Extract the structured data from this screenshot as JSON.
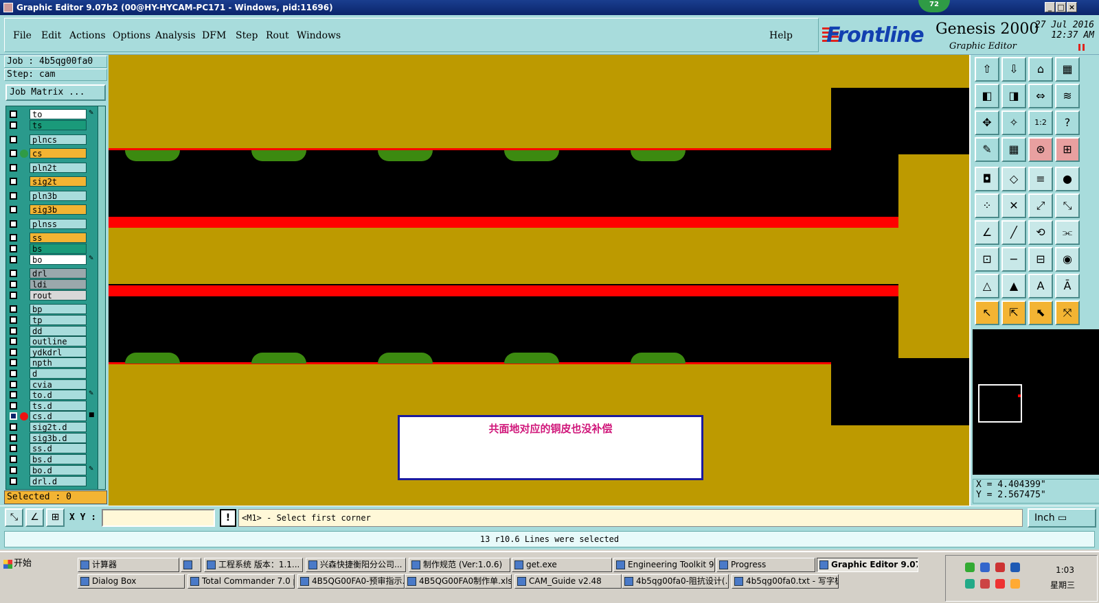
{
  "window": {
    "title": "Graphic Editor 9.07b2 (00@HY-HYCAM-PC171 - Windows, pid:11696)",
    "badge": "72",
    "min": "_",
    "max": "□",
    "close": "×"
  },
  "menu": {
    "items": [
      "File",
      "Edit",
      "Actions",
      "Options",
      "Analysis",
      "DFM",
      "Step",
      "Rout",
      "Windows"
    ],
    "help": "Help"
  },
  "brand": {
    "logo": "Frontline",
    "product": "Genesis 2000",
    "subtitle": "Graphic Editor",
    "date": "27 Jul 2016",
    "time": "12:37 AM"
  },
  "left": {
    "job": "Job : 4b5qg00fa0",
    "step": "Step: cam",
    "job_matrix": "Job Matrix ...",
    "selected": "Selected : 0"
  },
  "layers": [
    {
      "name": "to",
      "color": "#ffffff",
      "flag": "✎"
    },
    {
      "name": "ts",
      "color": "#1a9a7a",
      "flag": ""
    },
    {
      "name": "plncs",
      "color": "#a8dcdc",
      "flag": ""
    },
    {
      "name": "cs",
      "color": "#f3b433",
      "flag": "",
      "dot": "#2f9b45"
    },
    {
      "name": "pln2t",
      "color": "#a8dcdc",
      "flag": ""
    },
    {
      "name": "sig2t",
      "color": "#f3b433",
      "flag": ""
    },
    {
      "name": "pln3b",
      "color": "#a8dcdc",
      "flag": ""
    },
    {
      "name": "sig3b",
      "color": "#f3b433",
      "flag": ""
    },
    {
      "name": "plnss",
      "color": "#a8dcdc",
      "flag": ""
    },
    {
      "name": "ss",
      "color": "#f3b433",
      "flag": ""
    },
    {
      "name": "bs",
      "color": "#1a9a7a",
      "flag": ""
    },
    {
      "name": "bo",
      "color": "#ffffff",
      "flag": "✎"
    },
    {
      "name": "drl",
      "color": "#9aa8ac",
      "flag": ""
    },
    {
      "name": "ldi",
      "color": "#9aa8ac",
      "flag": ""
    },
    {
      "name": "rout",
      "color": "#d8d8d8",
      "flag": ""
    },
    {
      "name": "bp",
      "color": "#a8dcdc",
      "flag": ""
    },
    {
      "name": "tp",
      "color": "#a8dcdc",
      "flag": ""
    },
    {
      "name": "dd",
      "color": "#a8dcdc",
      "flag": ""
    },
    {
      "name": "outline",
      "color": "#a8dcdc",
      "flag": ""
    },
    {
      "name": "ydkdrl",
      "color": "#a8dcdc",
      "flag": ""
    },
    {
      "name": "npth",
      "color": "#a8dcdc",
      "flag": ""
    },
    {
      "name": "d",
      "color": "#a8dcdc",
      "flag": ""
    },
    {
      "name": "cvia",
      "color": "#a8dcdc",
      "flag": ""
    },
    {
      "name": "to.d",
      "color": "#a8dcdc",
      "flag": "✎"
    },
    {
      "name": "ts.d",
      "color": "#a8dcdc",
      "flag": ""
    },
    {
      "name": "cs.d",
      "color": "#a8dcdc",
      "flag": "■",
      "dot": "#ee1111",
      "checked": true
    },
    {
      "name": "sig2t.d",
      "color": "#a8dcdc",
      "flag": ""
    },
    {
      "name": "sig3b.d",
      "color": "#a8dcdc",
      "flag": ""
    },
    {
      "name": "ss.d",
      "color": "#a8dcdc",
      "flag": ""
    },
    {
      "name": "bs.d",
      "color": "#a8dcdc",
      "flag": ""
    },
    {
      "name": "bo.d",
      "color": "#a8dcdc",
      "flag": "✎"
    },
    {
      "name": "drl.d",
      "color": "#a8dcdc",
      "flag": ""
    }
  ],
  "canvas": {
    "note": "共面地对应的铜皮也没补偿"
  },
  "tools": [
    {
      "icon": "⇧",
      "name": "zoom-home-icon"
    },
    {
      "icon": "⇩",
      "name": "zoom-save-icon"
    },
    {
      "icon": "⌂",
      "name": "home-icon"
    },
    {
      "icon": "▦",
      "name": "window-icon"
    },
    {
      "icon": "◧",
      "name": "pan-left-icon"
    },
    {
      "icon": "◨",
      "name": "pan-right-icon"
    },
    {
      "icon": "⇔",
      "name": "zoom-width-icon"
    },
    {
      "icon": "≋",
      "name": "redraw-icon"
    },
    {
      "icon": "✥",
      "name": "fit-icon"
    },
    {
      "icon": "✧",
      "name": "center-icon"
    },
    {
      "icon": "1:2",
      "name": "scale-icon"
    },
    {
      "icon": "?",
      "name": "help-icon"
    },
    {
      "icon": "✎",
      "name": "pencil-icon"
    },
    {
      "icon": "▦",
      "name": "grid-icon"
    },
    {
      "icon": "⊛",
      "name": "snap-red-icon"
    },
    {
      "icon": "⊞",
      "name": "snap-grid-icon"
    },
    {
      "icon": "◘",
      "name": "pad-icon"
    },
    {
      "icon": "◇",
      "name": "surface-icon"
    },
    {
      "icon": "≡",
      "name": "ruler-icon"
    },
    {
      "icon": "●",
      "name": "circle-icon"
    },
    {
      "icon": "⁘",
      "name": "nodes-icon"
    },
    {
      "icon": "✕",
      "name": "cross-icon"
    },
    {
      "icon": "⤢",
      "name": "line-add-icon"
    },
    {
      "icon": "⤡",
      "name": "line-move-icon"
    },
    {
      "icon": "∠",
      "name": "angle-icon"
    },
    {
      "icon": "╱",
      "name": "diag-icon"
    },
    {
      "icon": "⟲",
      "name": "arc-icon"
    },
    {
      "icon": "⫘",
      "name": "mirror-icon"
    },
    {
      "icon": "⊡",
      "name": "pad-move-icon"
    },
    {
      "icon": "−",
      "name": "minus-icon"
    },
    {
      "icon": "⊟",
      "name": "measure-icon"
    },
    {
      "icon": "◉",
      "name": "blob-icon"
    },
    {
      "icon": "△",
      "name": "tri-1-icon"
    },
    {
      "icon": "▲",
      "name": "tri-2-icon"
    },
    {
      "icon": "A",
      "name": "tri-3-icon"
    },
    {
      "icon": "Ā",
      "name": "tri-4-icon"
    },
    {
      "icon": "↖",
      "name": "select-icon"
    },
    {
      "icon": "⇱",
      "name": "select-box-icon"
    },
    {
      "icon": "⬉",
      "name": "select-poly-icon"
    },
    {
      "icon": "⤧",
      "name": "select-net-icon"
    }
  ],
  "coords": {
    "x": "X = 4.404399\"",
    "y": "Y = 2.567475\""
  },
  "cmd": {
    "xy_label": "X Y :",
    "xy_value": "",
    "warn": "!",
    "prompt": "<M1> - Select first corner",
    "units": "Inch ▭"
  },
  "status": {
    "message": "13 r10.6 Lines were selected"
  },
  "taskbar": {
    "start": "开始",
    "row1": [
      "计算器",
      "",
      "工程系统  版本：1.1...",
      "兴森快捷衡阳分公司...",
      "制作规范 (Ver:1.0.6)",
      "get.exe",
      "Engineering Toolkit 9.0...",
      "Progress",
      "Graphic Editor 9.07b..."
    ],
    "row2": [
      "Dialog Box",
      "Total Commander 7.0 pu...",
      "4B5QG00FA0-预审指示....",
      "4B5QG00FA0制作单.xls ...",
      "CAM_Guide v2.48",
      "4b5qg00fa0-阻抗设计(...",
      "4b5qg00fa0.txt - 写字板"
    ],
    "time": "1:03",
    "day": "星期三"
  }
}
